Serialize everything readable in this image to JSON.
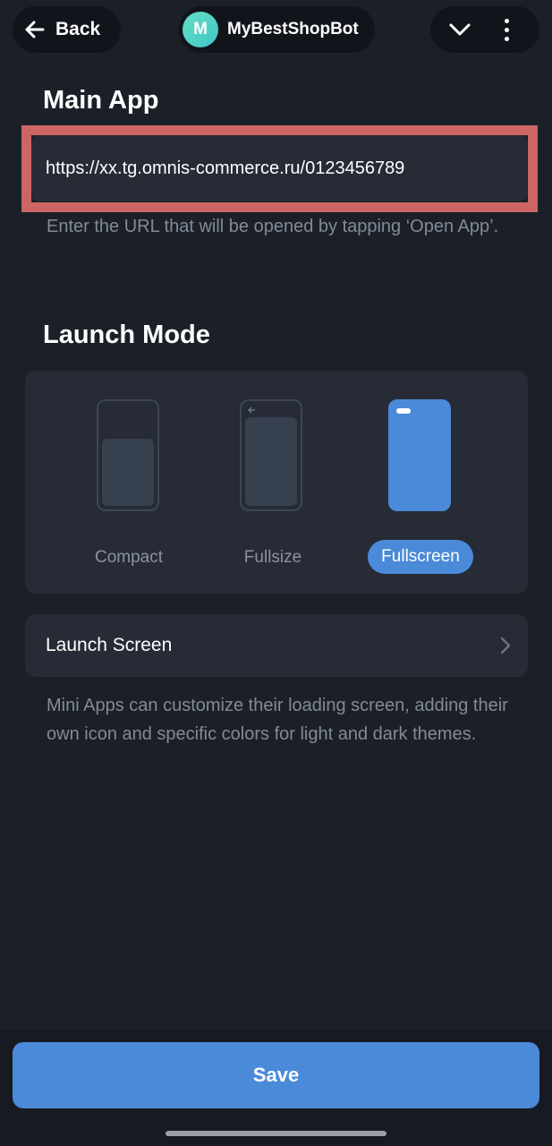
{
  "header": {
    "back_label": "Back",
    "bot_initial": "M",
    "bot_name": "MyBestShopBot"
  },
  "main_app": {
    "title": "Main App",
    "url_value": "https://xx.tg.omnis-commerce.ru/0123456789",
    "hint": "Enter the URL that will be opened by tapping ‘Open App’."
  },
  "launch_mode": {
    "title": "Launch Mode",
    "options": [
      "Compact",
      "Fullsize",
      "Fullscreen"
    ],
    "selected": "Fullscreen"
  },
  "launch_screen": {
    "label": "Launch Screen",
    "description": "Mini Apps can customize their loading screen, adding their own icon and specific colors for light and dark themes."
  },
  "footer": {
    "save_label": "Save"
  },
  "colors": {
    "background": "#1b2028",
    "card": "#262b35",
    "accent": "#4a8ad8",
    "highlight_border": "#cd6565",
    "muted_text": "#838a96"
  }
}
